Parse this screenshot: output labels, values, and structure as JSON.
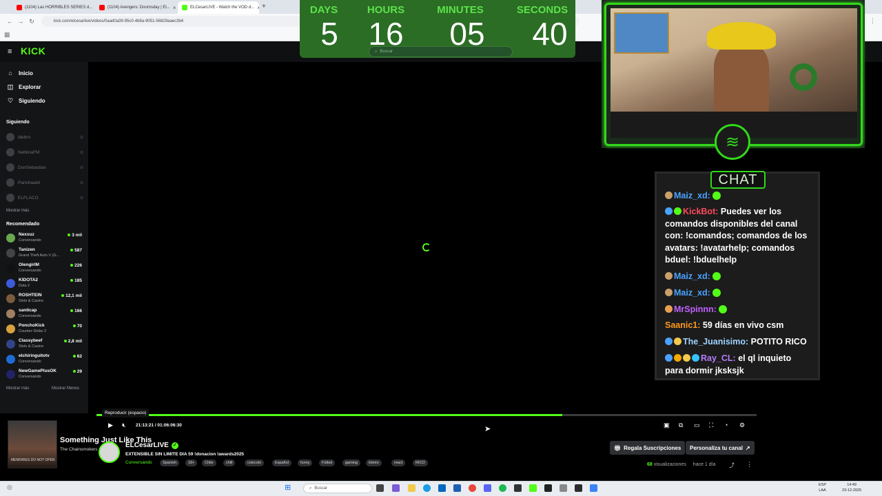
{
  "browser": {
    "tabs": [
      {
        "title": "(1104) Las HORRIBLES SERIES d...",
        "color": "#ff0000"
      },
      {
        "title": "(1104) Avengers: Doomsday | El...",
        "color": "#ff0000"
      },
      {
        "title": "ELCesarLIVE - Watch the VOD d...",
        "color": "#53fc18"
      }
    ],
    "url": "kick.com/elcesarlive/videos/0aad0a39-95c0-4b9a-9051-56829aaec3b4"
  },
  "kick": {
    "logo": "KICK",
    "nav": [
      {
        "label": "Inicio",
        "icon": "home-icon",
        "glyph": "⌂"
      },
      {
        "label": "Explorar",
        "icon": "compass-icon",
        "glyph": "◫"
      },
      {
        "label": "Siguiendo",
        "icon": "heart-icon",
        "glyph": "♡"
      }
    ],
    "following_title": "Siguiendo",
    "following": [
      "diebro",
      "NeblinaFM",
      "DonSebastian",
      "Panchaalel",
      "ELFLACO"
    ],
    "show_more": "Mostrar más",
    "recommended_title": "Recomendado",
    "recommended": [
      {
        "name": "Nexxuz",
        "game": "Conversando",
        "viewers": "3 mil",
        "color": "#6aa84f"
      },
      {
        "name": "Tanizen",
        "game": "Grand Theft Auto V (G...",
        "viewers": "587",
        "color": "#444"
      },
      {
        "name": "OlengirlM",
        "game": "Conversando",
        "viewers": "226",
        "color": "#111"
      },
      {
        "name": "KIDOTA2",
        "game": "Dota 2",
        "viewers": "185",
        "color": "#3b5bdb"
      },
      {
        "name": "ROSHTEIN",
        "game": "Slots & Casino",
        "viewers": "12,1 mil",
        "color": "#7a5c3c"
      },
      {
        "name": "santicap",
        "game": "Conversando",
        "viewers": "166",
        "color": "#a08060"
      },
      {
        "name": "PonchoKick",
        "game": "Counter-Strike 2",
        "viewers": "70",
        "color": "#d8a040"
      },
      {
        "name": "Classybeef",
        "game": "Slots & Casino",
        "viewers": "2,8 mil",
        "color": "#334488"
      },
      {
        "name": "elchiringuitotv",
        "game": "Conversando",
        "viewers": "62",
        "color": "#1e6bd6"
      },
      {
        "name": "NewGamePlusOK",
        "game": "Conversando",
        "viewers": "29",
        "color": "#222266"
      }
    ],
    "show_more_2": "Mostrar más",
    "show_less": "Mostrar Menos",
    "search_placeholder": "Buscar"
  },
  "countdown": {
    "labels": [
      "DAYS",
      "HOURS",
      "MINUTES",
      "SECONDS"
    ],
    "values": [
      "5",
      "16",
      "05",
      "40"
    ]
  },
  "chat": {
    "title": "CHAT",
    "messages": [
      {
        "user": "Maiz_xd:",
        "text": "",
        "ucolor": "#4aa3ff",
        "badges": [
          "#c9a06a"
        ]
      },
      {
        "user": "KickBot:",
        "text": "Puedes ver los comandos disponibles del canal con: !comandos; comandos de los avatars: !avatarhelp; comandos bduel: !bduelhelp",
        "ucolor": "#ff4a5c",
        "badges": [
          "#4aa3ff",
          "#53fc18"
        ]
      },
      {
        "user": "Maiz_xd:",
        "text": "",
        "ucolor": "#4aa3ff",
        "badges": [
          "#c9a06a"
        ]
      },
      {
        "user": "Maiz_xd:",
        "text": "",
        "ucolor": "#4aa3ff",
        "badges": [
          "#c9a06a"
        ]
      },
      {
        "user": "MrSpinnn:",
        "text": "",
        "ucolor": "#c061ff",
        "badges": [
          "#e8a050"
        ]
      },
      {
        "user": "Saanic1:",
        "text": "59 días en vivo csm",
        "ucolor": "#ff9a1e",
        "badges": []
      },
      {
        "user": "The_Juanisimo:",
        "text": "POTITO RICO",
        "ucolor": "#9fd3ff",
        "badges": [
          "#4aa3ff",
          "#f2c94c"
        ]
      },
      {
        "user": "Ray_CL:",
        "text": "el ql inquieto para dormir jksksjk",
        "ucolor": "#b77dff",
        "badges": [
          "#4aa3ff",
          "#f2a900",
          "#f2c94c",
          "#33c3ff"
        ]
      }
    ]
  },
  "player": {
    "tooltip": "Reproducir (espacio)",
    "time": "21:13:21 / 01:06:06:30",
    "progress": 0.706
  },
  "info": {
    "song": "Something Just Like This",
    "artist": "The Chainsmokers",
    "album_text": "MEMORIES DO NOT OPEN",
    "channel": "ELCesarLIVE",
    "stream_title": "EXTENSIBLE SIN LIMITE DIA 59 !donacion !awards2025",
    "category": "Conversando",
    "tags": [
      "Spanish",
      "18+",
      "Chile",
      "chill",
      "colocolo",
      "Español",
      "funny",
      "Fútbol",
      "gaming",
      "loleiro",
      "react",
      "RICO"
    ],
    "gift_button": "Regala Suscripciones",
    "customize_button": "Personaliza tu canal",
    "views_count": "68",
    "views_label": "visualizaciones",
    "ago": "hace 1 día"
  },
  "taskbar": {
    "search_placeholder": "Buscar",
    "lang_1": "ESP",
    "lang_2": "LAA",
    "time": "14:49",
    "date": "23-12-2025"
  }
}
